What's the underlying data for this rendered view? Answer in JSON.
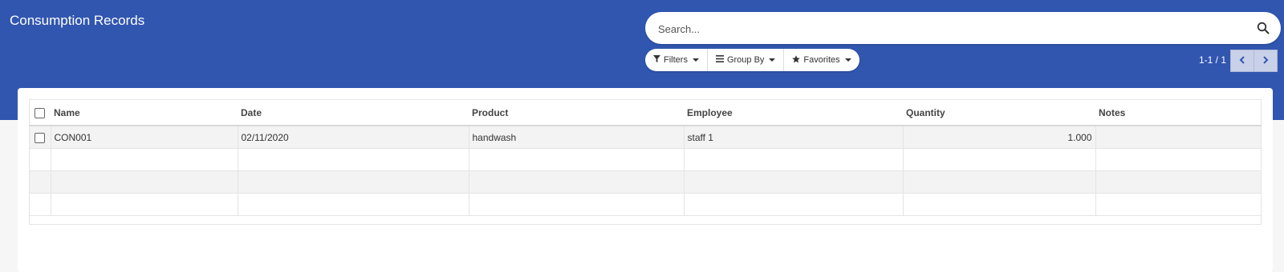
{
  "header": {
    "title": "Consumption Records"
  },
  "search": {
    "placeholder": "Search...",
    "value": ""
  },
  "filters": {
    "filters_label": "Filters",
    "group_by_label": "Group By",
    "favorites_label": "Favorites"
  },
  "pager": {
    "value": "1-1 / 1"
  },
  "table": {
    "columns": [
      "Name",
      "Date",
      "Product",
      "Employee",
      "Quantity",
      "Notes"
    ],
    "rows": [
      {
        "name": "CON001",
        "date": "02/11/2020",
        "product": "handwash",
        "employee": "staff 1",
        "quantity": "1.000",
        "notes": ""
      }
    ]
  },
  "colors": {
    "header_bg": "#3156b0",
    "page_bg": "#f6f6f6"
  },
  "icons": [
    "search-icon",
    "filter-icon",
    "list-icon",
    "star-icon",
    "chevron-left-icon",
    "chevron-right-icon"
  ]
}
